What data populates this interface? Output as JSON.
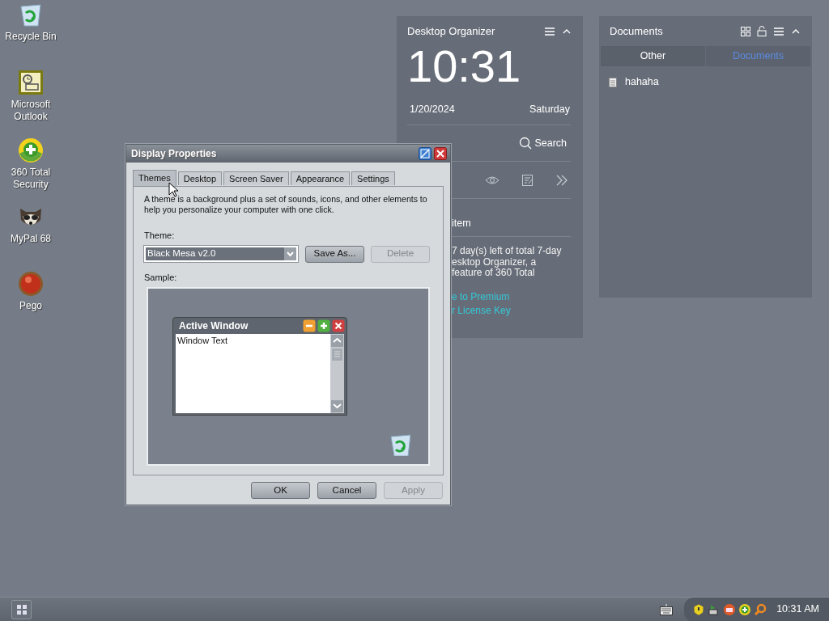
{
  "desktop_icons": [
    {
      "label": "Recycle Bin",
      "kind": "recycle"
    },
    {
      "label": "Microsoft Outlook",
      "kind": "outlook"
    },
    {
      "label": "360 Total Security",
      "kind": "security"
    },
    {
      "label": "MyPal 68",
      "kind": "raccoon"
    },
    {
      "label": "Pego",
      "kind": "orb"
    }
  ],
  "organizer": {
    "title": "Desktop Organizer",
    "time": "10:31",
    "date": "1/20/2024",
    "weekday": "Saturday",
    "search": "Search",
    "item_text": "item",
    "trial_lines": [
      "7 day(s) left of total 7-day",
      "esktop Organizer, a",
      "feature of 360 Total"
    ],
    "links": [
      "e to Premium",
      "r License Key"
    ]
  },
  "documents": {
    "title": "Documents",
    "tabs": [
      {
        "label": "Other",
        "selected": false
      },
      {
        "label": "Documents",
        "selected": true
      }
    ],
    "files": [
      "hahaha"
    ]
  },
  "dialog": {
    "title": "Display Properties",
    "tabs": [
      {
        "label": "Themes",
        "selected": true
      },
      {
        "label": "Desktop",
        "selected": false
      },
      {
        "label": "Screen Saver",
        "selected": false
      },
      {
        "label": "Appearance",
        "selected": false
      },
      {
        "label": "Settings",
        "selected": false
      }
    ],
    "description": "A theme is a background plus a set of sounds, icons, and other elements to help you personalize your computer with one click.",
    "theme_label": "Theme:",
    "theme_value": "Black Mesa v2.0",
    "side_buttons": [
      {
        "label": "Save As...",
        "disabled": false
      },
      {
        "label": "Delete",
        "disabled": true
      }
    ],
    "sample_label": "Sample:",
    "sample_window": {
      "title": "Active Window",
      "text": "Window Text"
    },
    "buttons": [
      {
        "label": "OK",
        "disabled": false
      },
      {
        "label": "Cancel",
        "disabled": false
      },
      {
        "label": "Apply",
        "disabled": true
      }
    ]
  },
  "taskbar": {
    "clock": "10:31 AM"
  }
}
